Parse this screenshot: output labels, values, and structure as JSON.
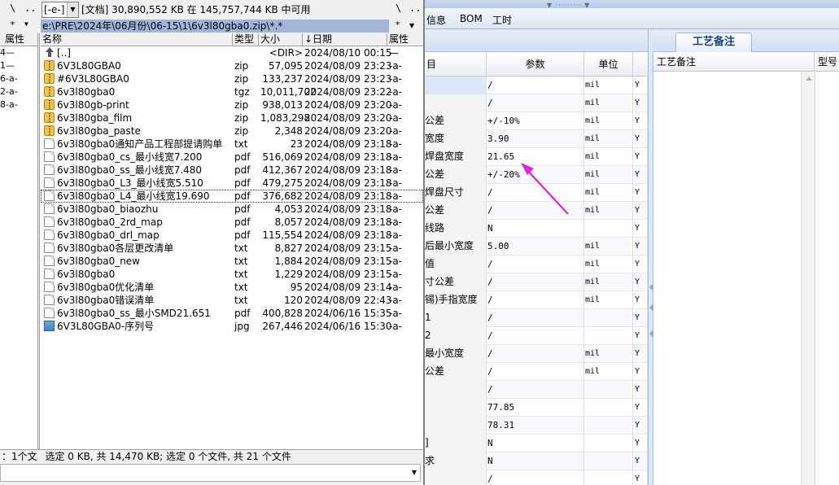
{
  "file_manager": {
    "left_panel": {
      "toolbar": {
        "root_label": "\\",
        "up_label": "..",
        "star_label": "*",
        "dropdown_glyph": "▼"
      },
      "header_attr": "属性",
      "rows": [
        "4—",
        "1—",
        "6-a-",
        "2-a-",
        "8-a-"
      ],
      "status": "：1个文"
    },
    "drive": {
      "label": "[-e-]",
      "dropdown_glyph": "▼"
    },
    "drive_info": "[文档]  30,890,552 KB 在 145,757,744 KB 中可用",
    "path": "e:\\PRE\\2024年\\06月份\\06-15\\1\\6v3l80gba0.zip\\*.*",
    "root_label": "\\",
    "up_label": "..",
    "star_label": "*",
    "dropdown_glyph": "▼",
    "columns": {
      "name": "名称",
      "ext": "类型",
      "size": "大小",
      "date": "↓日期",
      "attr": "属性"
    },
    "files": [
      {
        "icon": "up",
        "name": "[..]",
        "ext": "",
        "size": "<DIR>",
        "date": "2024/08/10 00:15",
        "attr": "—"
      },
      {
        "icon": "zip",
        "name": "6V3L80GBA0",
        "ext": "zip",
        "size": "57,095",
        "date": "2024/08/09 23:23",
        "attr": "-a-"
      },
      {
        "icon": "zip",
        "name": "#6V3L80GBA0",
        "ext": "zip",
        "size": "133,237",
        "date": "2024/08/09 23:23",
        "attr": "-a-"
      },
      {
        "icon": "zip",
        "name": "6v3l80gba0",
        "ext": "tgz",
        "size": "10,011,702",
        "date": "2024/08/09 23:22",
        "attr": "-a-"
      },
      {
        "icon": "zip",
        "name": "6v3l80gb-print",
        "ext": "zip",
        "size": "938,013",
        "date": "2024/08/09 23:20",
        "attr": "-a-"
      },
      {
        "icon": "zip",
        "name": "6v3l80gba_film",
        "ext": "zip",
        "size": "1,083,298",
        "date": "2024/08/09 23:20",
        "attr": "-a-"
      },
      {
        "icon": "zip",
        "name": "6v3l80gba_paste",
        "ext": "zip",
        "size": "2,348",
        "date": "2024/08/09 23:20",
        "attr": "-a-"
      },
      {
        "icon": "doc",
        "name": "6v3l80gba0通知产品工程部提请购单",
        "ext": "txt",
        "size": "23",
        "date": "2024/08/09 23:18",
        "attr": "-a-"
      },
      {
        "icon": "doc",
        "name": "6v3l80gba0_cs_最小线宽7.200",
        "ext": "pdf",
        "size": "516,069",
        "date": "2024/08/09 23:18",
        "attr": "-a-"
      },
      {
        "icon": "doc",
        "name": "6v3l80gba0_ss_最小线宽7.480",
        "ext": "pdf",
        "size": "412,367",
        "date": "2024/08/09 23:18",
        "attr": "-a-"
      },
      {
        "icon": "doc",
        "name": "6v3l80gba0_L3_最小线宽5.510",
        "ext": "pdf",
        "size": "479,275",
        "date": "2024/08/09 23:18",
        "attr": "-a-"
      },
      {
        "icon": "doc",
        "name": "6v3l80gba0_L4_最小线宽19.690",
        "ext": "pdf",
        "size": "376,682",
        "date": "2024/08/09 23:18",
        "attr": "-a-",
        "selected": true
      },
      {
        "icon": "doc",
        "name": "6v3l80gba0_biaozhu",
        "ext": "pdf",
        "size": "4,053",
        "date": "2024/08/09 23:18",
        "attr": "-a-"
      },
      {
        "icon": "doc",
        "name": "6v3l80gba0_2rd_map",
        "ext": "pdf",
        "size": "8,057",
        "date": "2024/08/09 23:18",
        "attr": "-a-"
      },
      {
        "icon": "doc",
        "name": "6v3l80gba0_drl_map",
        "ext": "pdf",
        "size": "115,554",
        "date": "2024/08/09 23:18",
        "attr": "-a-"
      },
      {
        "icon": "doc",
        "name": "6v3l80gba0各层更改清单",
        "ext": "txt",
        "size": "8,827",
        "date": "2024/08/09 23:15",
        "attr": "-a-"
      },
      {
        "icon": "doc",
        "name": "6v3l80gba0_new",
        "ext": "txt",
        "size": "1,884",
        "date": "2024/08/09 23:15",
        "attr": "-a-"
      },
      {
        "icon": "doc",
        "name": "6v3l80gba0",
        "ext": "txt",
        "size": "1,229",
        "date": "2024/08/09 23:15",
        "attr": "-a-"
      },
      {
        "icon": "doc",
        "name": "6v3l80gba0优化清单",
        "ext": "txt",
        "size": "95",
        "date": "2024/08/09 23:14",
        "attr": "-a-"
      },
      {
        "icon": "doc",
        "name": "6v3l80gba0错误清单",
        "ext": "txt",
        "size": "120",
        "date": "2024/08/09 22:43",
        "attr": "-a-"
      },
      {
        "icon": "doc",
        "name": "6v3l80gba0_ss_最小SMD21.651",
        "ext": "pdf",
        "size": "400,828",
        "date": "2024/06/16 15:35",
        "attr": "-a-"
      },
      {
        "icon": "img",
        "name": "6V3L80GBA0-序列号",
        "ext": "jpg",
        "size": "267,446",
        "date": "2024/06/16 15:30",
        "attr": "-a-"
      }
    ],
    "status": "选定 0 KB, 共 14,470 KB; 选定 0 个文件, 共 21 个文件"
  },
  "app": {
    "menu": [
      "信息",
      "BOM",
      "工时"
    ],
    "grid": {
      "columns": [
        "目",
        "参数",
        "单位",
        ""
      ],
      "rows": [
        {
          "item": "",
          "param": "/",
          "unit": "mil",
          "flag": "Y",
          "blue": true
        },
        {
          "item": "",
          "param": "/",
          "unit": "mil",
          "flag": "Y"
        },
        {
          "item": "公差",
          "param": "+/-10%",
          "unit": "mil",
          "flag": "Y"
        },
        {
          "item": "宽度",
          "param": "3.90",
          "unit": "mil",
          "flag": "Y"
        },
        {
          "item": "焊盘宽度",
          "param": "21.65",
          "unit": "mil",
          "flag": "Y"
        },
        {
          "item": "公差",
          "param": "+/-20%",
          "unit": "mil",
          "flag": "Y"
        },
        {
          "item": "焊盘尺寸",
          "param": "/",
          "unit": "mil",
          "flag": "Y"
        },
        {
          "item": "公差",
          "param": "/",
          "unit": "mil",
          "flag": "Y"
        },
        {
          "item": "线路",
          "param": "N",
          "unit": "",
          "flag": "Y"
        },
        {
          "item": "后最小宽度",
          "param": "5.00",
          "unit": "mil",
          "flag": "Y"
        },
        {
          "item": "值",
          "param": "/",
          "unit": "mil",
          "flag": "Y"
        },
        {
          "item": "寸公差",
          "param": "/",
          "unit": "mil",
          "flag": "Y"
        },
        {
          "item": "锡)手指宽度",
          "param": "/",
          "unit": "mil",
          "flag": "Y"
        },
        {
          "item": "1",
          "param": "/",
          "unit": "",
          "flag": "Y"
        },
        {
          "item": "2",
          "param": "/",
          "unit": "",
          "flag": "Y"
        },
        {
          "item": "最小宽度",
          "param": "/",
          "unit": "mil",
          "flag": "Y"
        },
        {
          "item": "公差",
          "param": "/",
          "unit": "mil",
          "flag": "Y"
        },
        {
          "item": "",
          "param": "/",
          "unit": "",
          "flag": "Y"
        },
        {
          "item": "",
          "param": "77.85",
          "unit": "",
          "flag": "Y"
        },
        {
          "item": "",
          "param": "78.31",
          "unit": "",
          "flag": "Y"
        },
        {
          "item": "]",
          "param": "N",
          "unit": "",
          "flag": "Y"
        },
        {
          "item": "求",
          "param": "N",
          "unit": "",
          "flag": "Y"
        },
        {
          "item": "",
          "param": "/",
          "unit": "",
          "flag": "Y"
        }
      ]
    },
    "notes": {
      "tab": "工艺备注",
      "columns": [
        "工艺备注",
        "型号"
      ]
    },
    "colors": {
      "accent": "#99bbe8",
      "arrow": "#e020e0",
      "path_bar": "#9fb6d8"
    }
  }
}
